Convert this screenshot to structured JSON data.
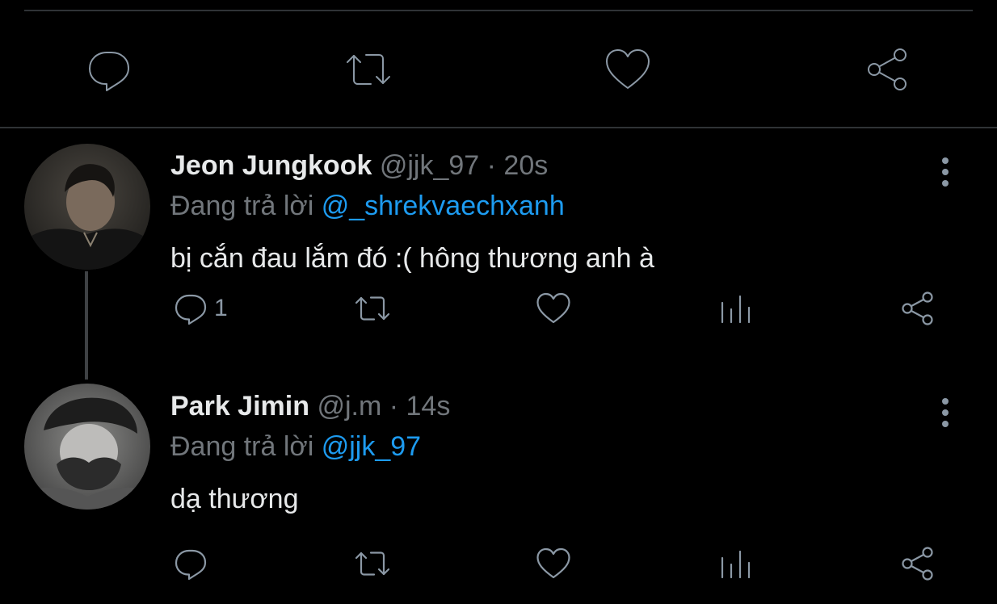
{
  "top_actions": {
    "reply_icon": "reply-icon",
    "retweet_icon": "retweet-icon",
    "like_icon": "heart-icon",
    "share_icon": "share-icon"
  },
  "tweets": [
    {
      "name": "Jeon Jungkook",
      "handle": "@jjk_97",
      "separator": "·",
      "time": "20s",
      "reply_prefix": "Đang trả lời",
      "reply_to": "@_shrekvaechxanh",
      "text": "bị cắn đau lắm đó :( hông thương anh à",
      "reply_count": "1"
    },
    {
      "name": "Park Jimin",
      "handle": "@j.m",
      "separator": "·",
      "time": "14s",
      "reply_prefix": "Đang trả lời",
      "reply_to": "@jjk_97",
      "text": "dạ thương",
      "reply_count": ""
    }
  ],
  "colors": {
    "background": "#000000",
    "text": "#e7e9ea",
    "muted": "#71767b",
    "icon": "#8b98a5",
    "mention": "#1d9bf0",
    "divider": "#2f3336"
  }
}
